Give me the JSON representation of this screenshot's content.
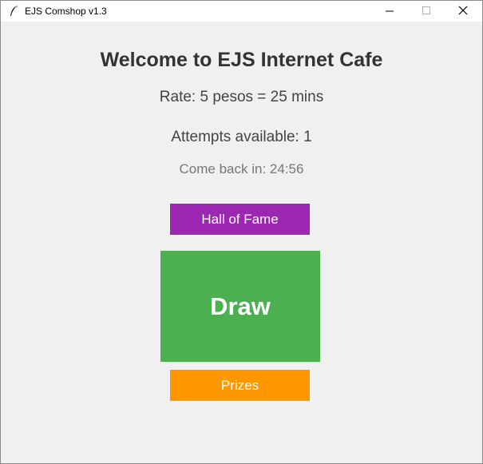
{
  "window": {
    "title": "EJS Comshop v1.3",
    "controls": {
      "minimize_icon": "minimize-icon",
      "maximize_icon": "maximize-icon",
      "close_icon": "close-icon"
    }
  },
  "main": {
    "heading": "Welcome to EJS Internet Cafe",
    "rate": "Rate: 5 pesos = 25 mins",
    "attempts": "Attempts available: 1",
    "come_back": "Come back in: 24:56",
    "hall_of_fame_label": "Hall of Fame",
    "draw_label": "Draw",
    "prizes_label": "Prizes"
  },
  "colors": {
    "hall_of_fame": "#9c27b0",
    "draw": "#4caf50",
    "prizes": "#ff9800",
    "background": "#f0f0f0"
  }
}
